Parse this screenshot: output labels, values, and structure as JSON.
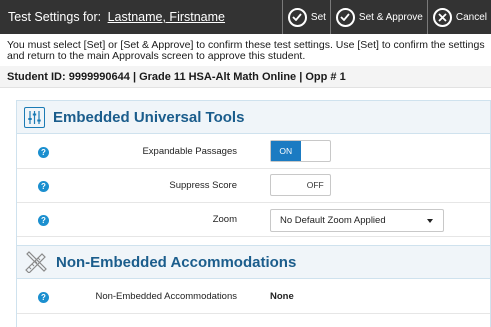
{
  "header": {
    "title_prefix": "Test Settings for:",
    "student_name": "Lastname, Firstname",
    "buttons": {
      "set": "Set",
      "set_approve": "Set & Approve",
      "cancel": "Cancel"
    }
  },
  "instructions": "You must select [Set] or [Set & Approve] to confirm these test settings. Use [Set] to confirm the settings and return to the main Approvals screen to approve this student.",
  "student_info": "Student ID: 9999990644 | Grade 11 HSA-Alt Math Online | Opp # 1",
  "panels": [
    {
      "title": "Embedded Universal Tools",
      "icon": "sliders-icon",
      "rows": [
        {
          "label": "Expandable Passages",
          "on_label": "ON",
          "off_label": "",
          "state": "on"
        },
        {
          "label": "Suppress Score",
          "on_label": "",
          "off_label": "OFF",
          "state": "off"
        },
        {
          "label": "Zoom",
          "selected": "No Default Zoom Applied"
        }
      ]
    },
    {
      "title": "Non-Embedded Accommodations",
      "icon": "pencil-ruler-icon",
      "rows": [
        {
          "label": "Non-Embedded Accommodations",
          "value": "None"
        }
      ]
    }
  ],
  "help_glyph": "?",
  "colors": {
    "titlebar": "#333333",
    "panel_title": "#1b5d8c",
    "accent": "#1b7bc2",
    "help": "#1b8fcf"
  }
}
